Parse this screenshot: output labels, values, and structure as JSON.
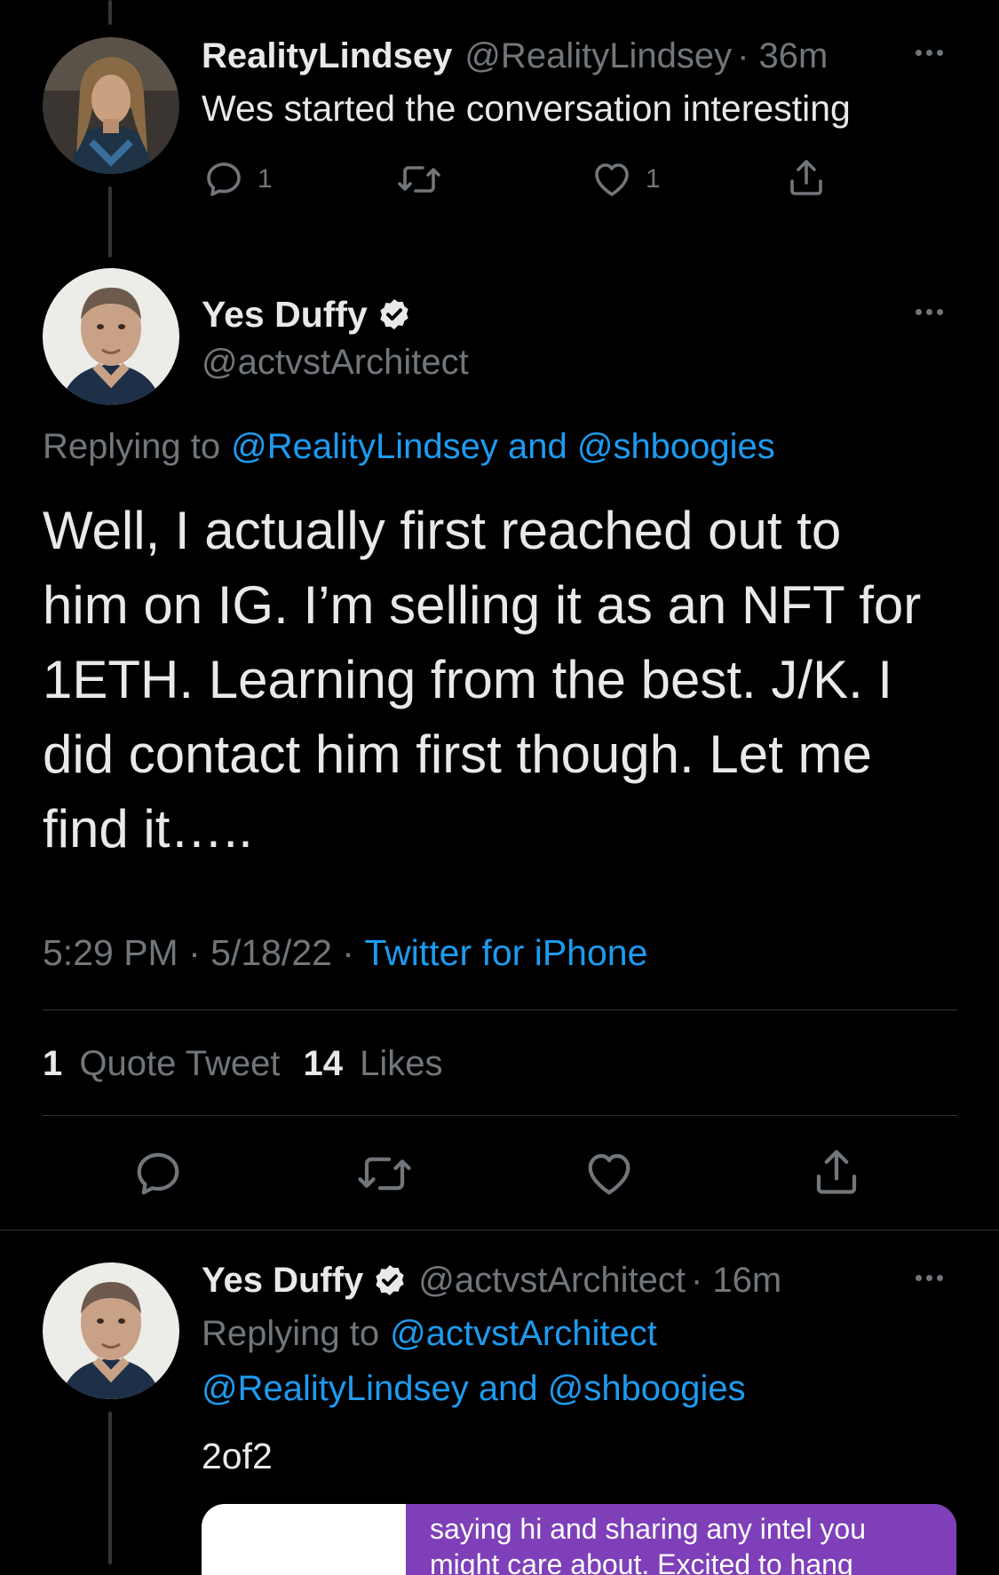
{
  "tweet1": {
    "display_name": "RealityLindsey",
    "handle": "@RealityLindsey",
    "time": "· 36m",
    "text": "Wes started the conversation interesting",
    "reply_count": "1",
    "like_count": "1"
  },
  "main_tweet": {
    "display_name": "Yes Duffy",
    "handle": "@actvstArchitect",
    "replying_prefix": "Replying to",
    "replying_to": "@RealityLindsey and @shboogies",
    "text_lines": [
      "Well, I actually first reached out to",
      "him on IG. I’m selling it as an NFT for",
      "1ETH. Learning from the best. J/K. I",
      "did contact him first though. Let me",
      "find it….."
    ],
    "timestamp": "5:29 PM · 5/18/22 · ",
    "source": "Twitter for iPhone",
    "quote_count": "1",
    "quote_label": "Quote Tweet",
    "like_count": "14",
    "like_label": "Likes"
  },
  "tweet3": {
    "display_name": "Yes Duffy",
    "handle": "@actvstArchitect",
    "time": "· 16m",
    "replying_prefix": "Replying to",
    "replying_line1": "@actvstArchitect",
    "replying_line2": "@RealityLindsey and @shboogies",
    "text": "2of2",
    "image_message_line1": "saying hi and sharing any intel you",
    "image_message_line2": "might care about. Excited to hang"
  },
  "colors": {
    "background": "#000000",
    "text": "#e7e9ea",
    "muted": "#71767b",
    "link": "#1d9bf0",
    "divider": "#2f3336",
    "message_bubble": "#7e3fb8"
  },
  "icons": {
    "reply": "speech-bubble-icon",
    "retweet": "retweet-arrows-icon",
    "like": "heart-icon",
    "share": "share-upload-icon",
    "more": "more-dots-icon",
    "verified": "verified-badge-icon"
  }
}
